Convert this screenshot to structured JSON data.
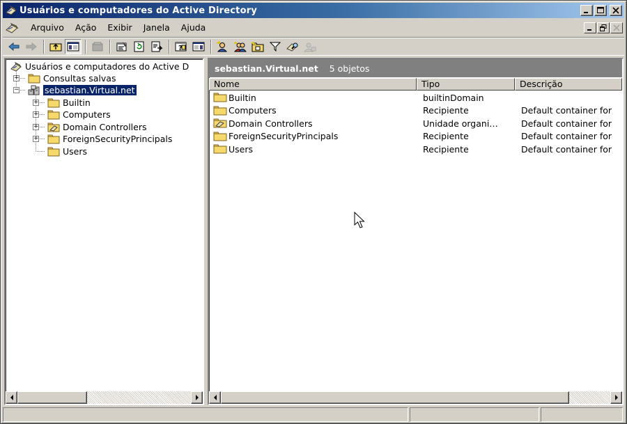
{
  "window": {
    "title": "Usuários e computadores do Active Directory"
  },
  "menu": [
    {
      "label": "Arquivo",
      "id": "arquivo"
    },
    {
      "label": "Ação",
      "id": "acao"
    },
    {
      "label": "Exibir",
      "id": "exibir"
    },
    {
      "label": "Janela",
      "id": "janela"
    },
    {
      "label": "Ajuda",
      "id": "ajuda"
    }
  ],
  "tree": {
    "root": "Usuários e computadores do Active D",
    "saved_queries": "Consultas salvas",
    "domain": "sebastian.Virtual.net",
    "children": [
      {
        "label": "Builtin",
        "icon": "folder-icon"
      },
      {
        "label": "Computers",
        "icon": "folder-icon"
      },
      {
        "label": "Domain Controllers",
        "icon": "ou-folder-icon"
      },
      {
        "label": "ForeignSecurityPrincipals",
        "icon": "folder-icon"
      },
      {
        "label": "Users",
        "icon": "folder-icon"
      }
    ]
  },
  "list": {
    "context": "sebastian.Virtual.net",
    "count": "5 objetos",
    "columns": {
      "name": "Nome",
      "type": "Tipo",
      "description": "Descrição"
    },
    "rows": [
      {
        "name": "Builtin",
        "type": "builtinDomain",
        "description": "",
        "icon": "folder-icon"
      },
      {
        "name": "Computers",
        "type": "Recipiente",
        "description": "Default container for",
        "icon": "folder-icon"
      },
      {
        "name": "Domain Controllers",
        "type": "Unidade organi…",
        "description": "Default container for",
        "icon": "ou-folder-icon"
      },
      {
        "name": "ForeignSecurityPrincipals",
        "type": "Recipiente",
        "description": "Default container for",
        "icon": "folder-icon"
      },
      {
        "name": "Users",
        "type": "Recipiente",
        "description": "Default container for",
        "icon": "folder-icon"
      }
    ]
  },
  "colors": {
    "title_start": "#0a246a",
    "title_end": "#a6caf0",
    "face": "#d4d0c8",
    "selection": "#0a246a",
    "folder": "#f5d96b"
  }
}
